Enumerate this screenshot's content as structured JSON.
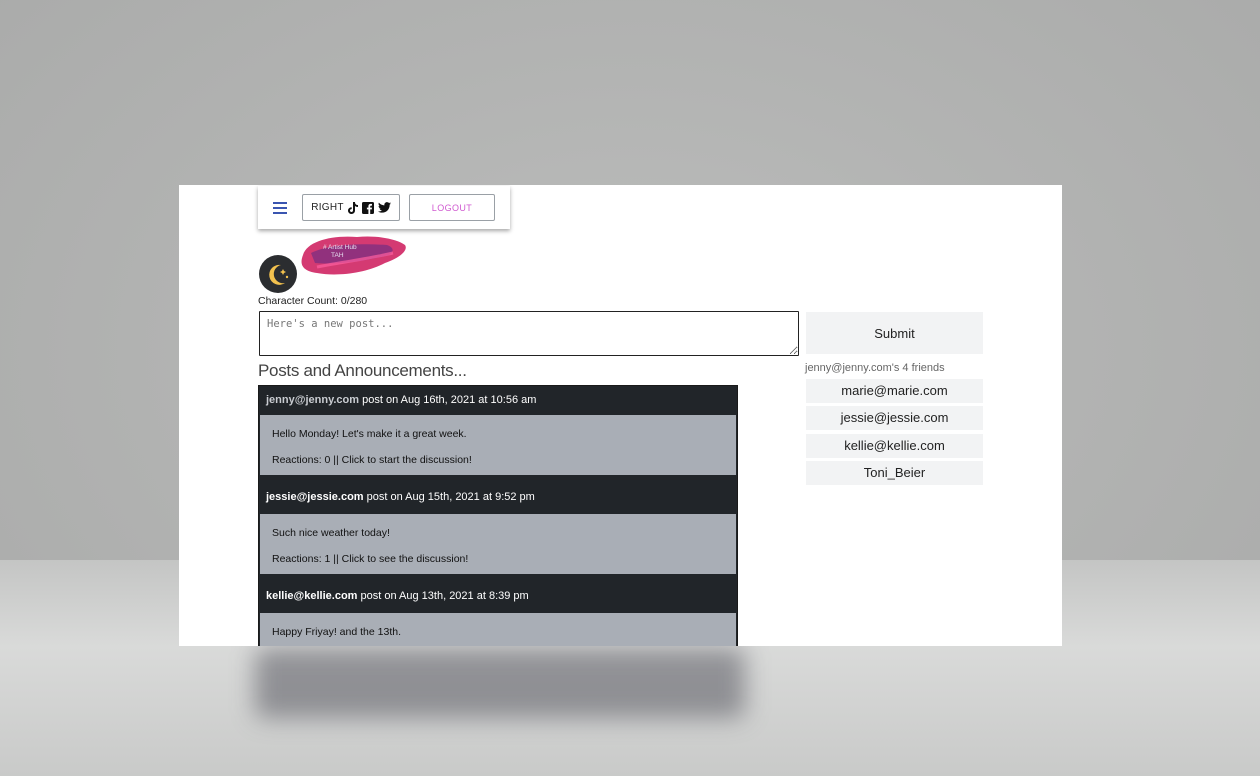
{
  "nav": {
    "right_label": "RIGHT",
    "logout_label": "LOGOUT"
  },
  "logo": {
    "line1": "# Artist Hub",
    "line2": "TAH"
  },
  "composer": {
    "char_count": "Character Count: 0/280",
    "placeholder": "Here's a new post...",
    "submit_label": "Submit"
  },
  "feed": {
    "title": "Posts and Announcements...",
    "posts": [
      {
        "author": "jenny@jenny.com",
        "meta": " post on Aug 16th, 2021 at 10:56 am",
        "text": "Hello Monday! Let's make it a great week.",
        "reactions": "Reactions: 0 || Click to start the discussion!"
      },
      {
        "author": "jessie@jessie.com",
        "meta": " post on Aug 15th, 2021 at 9:52 pm",
        "text": "Such nice weather today!",
        "reactions": "Reactions: 1 || Click to see the discussion!"
      },
      {
        "author": "kellie@kellie.com",
        "meta": " post on Aug 13th, 2021 at 8:39 pm",
        "text": "Happy Friyay! and the 13th.",
        "reactions": ""
      }
    ]
  },
  "friends": {
    "label": "jenny@jenny.com's 4 friends",
    "items": [
      "marie@marie.com",
      "jessie@jessie.com",
      "kellie@kellie.com",
      "Toni_Beier"
    ]
  },
  "colors": {
    "accent_link": "#d05ad0",
    "menu_icon": "#3a55b0",
    "feed_header_bg": "#212529",
    "post_body_bg": "#a9aeb6"
  }
}
